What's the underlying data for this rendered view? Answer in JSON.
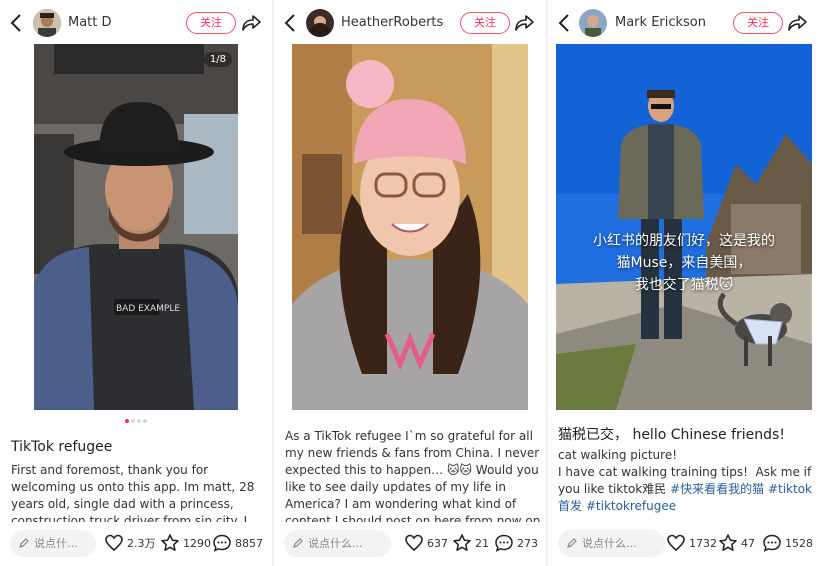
{
  "colors": {
    "accent": "#ff2d55",
    "hashtag": "#2a5e9c"
  },
  "posts": [
    {
      "user": "Matt D",
      "follow_label": "关注",
      "image_counter": "1/8",
      "title": "TikTok refugee",
      "body": "First and foremost, thank you for welcoming us onto this app. Im matt, 28 years old, single dad with a princess,     construction truck driver from sin city. I ride harleys and go",
      "comment_placeholder": "说点什…",
      "likes": "2.3万",
      "favorites": "1290",
      "comments": "8857"
    },
    {
      "user": "HeatherRoberts",
      "follow_label": "关注",
      "body": "As a TikTok refugee I`m so grateful for all my new friends & fans from China. I never expected this to happen… 🐱🐱 Would you like to see daily updates of my life in America? I am wondering what kind of content I should post on here from now on",
      "comment_placeholder": "说点什么...",
      "likes": "637",
      "favorites": "21",
      "comments": "273"
    },
    {
      "user": "Mark Erickson",
      "follow_label": "关注",
      "overlay_line1": "小红书的朋友们好，这是我的",
      "overlay_line2": "猫Muse，来自美国，",
      "overlay_line3": "我也交了猫税🐱",
      "title": "猫税已交， hello Chinese friends!",
      "body_text": "cat walking picture!\nI have cat walking training tips!  Ask me if you like tiktok难民 ",
      "tags": [
        "#快来看看我的猫",
        "#tiktok首发",
        "#tiktokrefugee"
      ],
      "comment_placeholder": "说点什么...",
      "likes": "1732",
      "favorites": "47",
      "comments": "1528"
    }
  ]
}
